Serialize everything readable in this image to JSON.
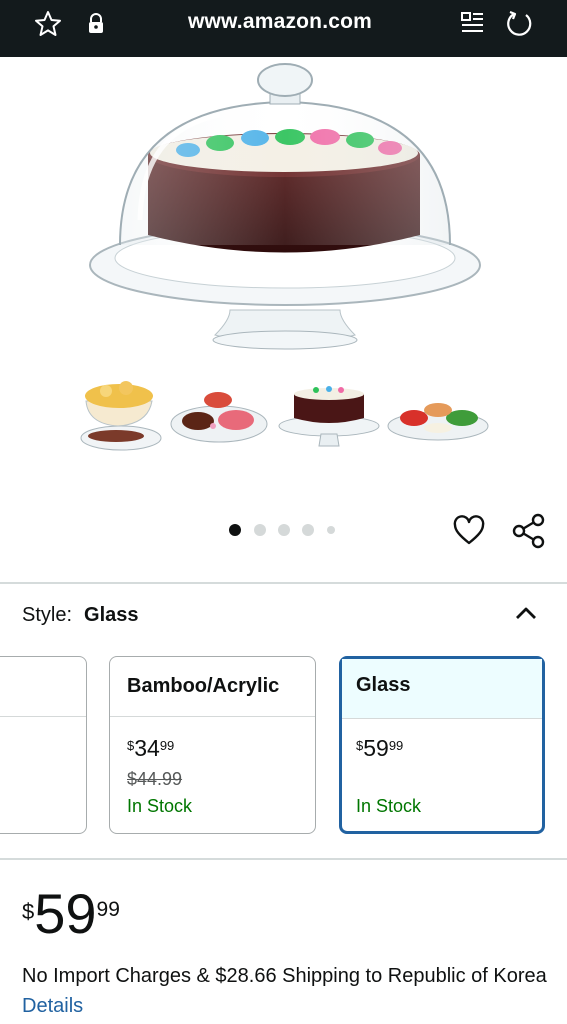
{
  "browser": {
    "url": "www.amazon.com",
    "icons": [
      "star-icon",
      "lock-icon",
      "reader-mode-icon",
      "reload-icon"
    ]
  },
  "gallery": {
    "main_image": "glass cake stand with dome",
    "thumbnails": [
      "popcorn-bowl",
      "snack-platter",
      "cake-stand",
      "veggie-tray"
    ],
    "dots_count": 5,
    "active_dot": 0
  },
  "style_selector": {
    "label": "Style:",
    "value": "Glass",
    "options": [
      {
        "name": "",
        "price_whole": "",
        "price_fraction": "",
        "list_price": "",
        "stock": ""
      },
      {
        "name": "Bamboo/Acrylic",
        "currency": "$",
        "price_whole": "34",
        "price_fraction": "99",
        "list_price": "$44.99",
        "stock": "In Stock"
      },
      {
        "name": "Glass",
        "currency": "$",
        "price_whole": "59",
        "price_fraction": "99",
        "list_price": "",
        "stock": "In Stock"
      }
    ]
  },
  "price": {
    "currency": "$",
    "whole": "59",
    "fraction": "99"
  },
  "shipping": {
    "text": "No Import Charges & $28.66 Shipping to Republic of Korea",
    "link": "Details"
  },
  "colors": {
    "topbar": "#131a1c",
    "link": "#2162a1",
    "stock": "#007600",
    "selected_border": "#2162a1",
    "selected_header_bg": "#edfdff"
  }
}
